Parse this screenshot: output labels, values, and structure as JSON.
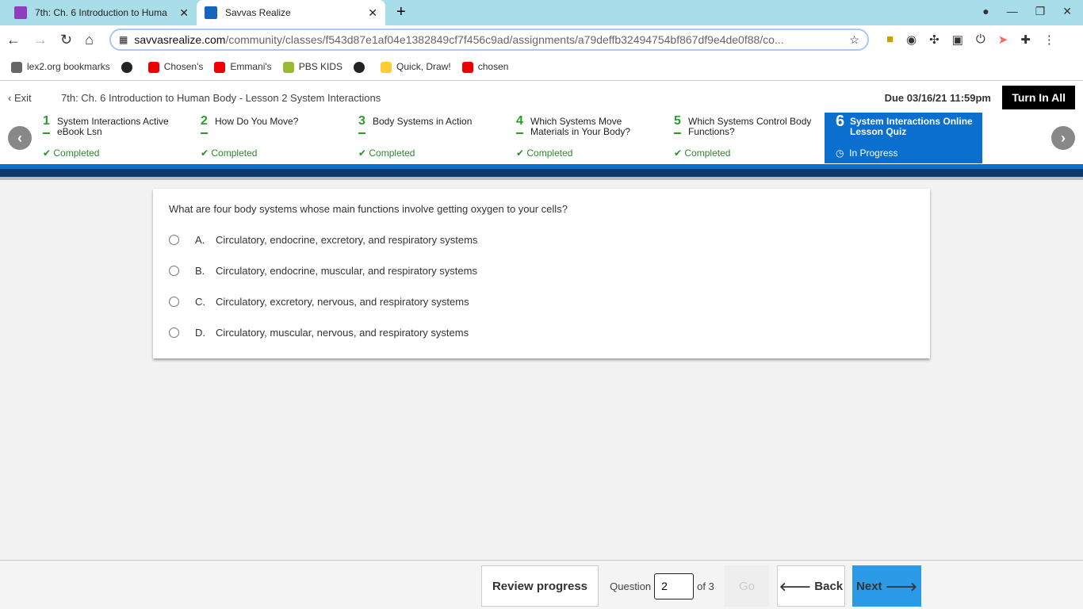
{
  "browser": {
    "tabs": [
      {
        "title": "7th: Ch. 6 Introduction to Huma",
        "icon": "classroom-icon"
      },
      {
        "title": "Savvas Realize",
        "icon": "savvas-icon"
      }
    ],
    "url_domain": "savvasrealize.com",
    "url_path": "/community/classes/f543d87e1af04e1382849cf7f456c9ad/assignments/a79deffb32494754bf867df9e4de0f88/co...",
    "bookmarks": [
      "lex2.org bookmarks",
      "Chosen's",
      "Emmani's",
      "PBS KIDS",
      "Quick, Draw!",
      "chosen"
    ]
  },
  "header": {
    "exit": "Exit",
    "title": "7th: Ch. 6 Introduction to Human Body - Lesson 2 System Interactions",
    "due": "Due 03/16/21 11:59pm",
    "turn_in": "Turn In All"
  },
  "steps": [
    {
      "num": "1",
      "label": "System Interactions Active eBook Lsn",
      "status": "Completed"
    },
    {
      "num": "2",
      "label": "How Do You Move?",
      "status": "Completed"
    },
    {
      "num": "3",
      "label": "Body Systems in Action",
      "status": "Completed"
    },
    {
      "num": "4",
      "label": "Which Systems Move Materials in Your Body?",
      "status": "Completed"
    },
    {
      "num": "5",
      "label": "Which Systems Control Body Functions?",
      "status": "Completed"
    },
    {
      "num": "6",
      "label": "System Interactions Online Lesson Quiz",
      "status": "In Progress"
    }
  ],
  "question": {
    "text": "What are four body systems whose main functions involve getting oxygen to your cells?",
    "options": [
      {
        "letter": "A.",
        "text": "Circulatory, endocrine, excretory, and respiratory systems"
      },
      {
        "letter": "B.",
        "text": "Circulatory, endocrine, muscular, and respiratory systems"
      },
      {
        "letter": "C.",
        "text": "Circulatory, excretory, nervous, and respiratory systems"
      },
      {
        "letter": "D.",
        "text": "Circulatory, muscular, nervous, and respiratory systems"
      }
    ]
  },
  "footer": {
    "review": "Review progress",
    "question_label": "Question",
    "current": "2",
    "of": "of 3",
    "go": "Go",
    "back": "Back",
    "next": "Next"
  }
}
